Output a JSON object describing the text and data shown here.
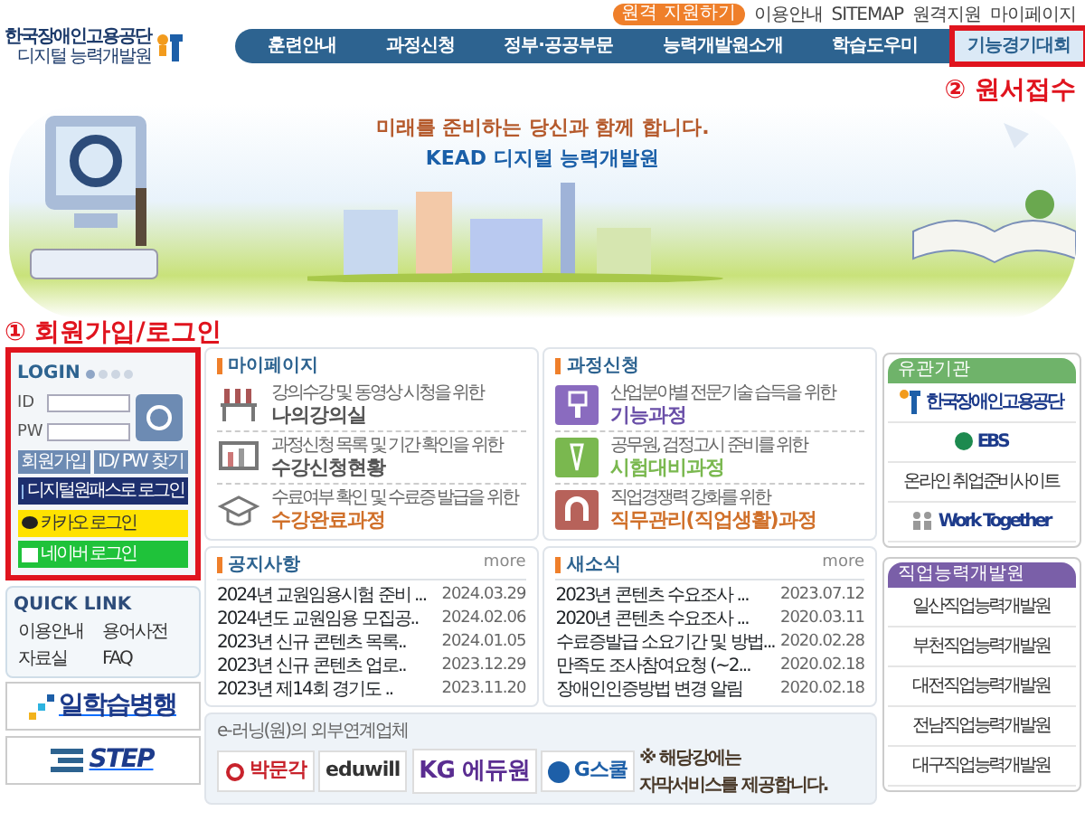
{
  "header": {
    "logo": {
      "line1": "한국장애인고용공단",
      "line2": "디지털 능력개발원"
    },
    "top_button": "원격 지원하기",
    "top_links": [
      "이용안내",
      "SITEMAP",
      "원격지원",
      "마이페이지"
    ],
    "nav": [
      {
        "label": "훈련안내",
        "selected": false
      },
      {
        "label": "과정신청",
        "selected": false
      },
      {
        "label": "정부·공공부문",
        "selected": false
      },
      {
        "label": "능력개발원소개",
        "selected": false
      },
      {
        "label": "학습도우미",
        "selected": false
      },
      {
        "label": "기능경기대회",
        "selected": true
      }
    ]
  },
  "annotations": [
    {
      "number": "②",
      "label": "원서접수"
    },
    {
      "number": "①",
      "label": "회원가입/로그인"
    }
  ],
  "banner": {
    "tagline": "미래를 준비하는 당신과 함께 합니다.",
    "title": "KEAD 디지털 능력개발원"
  },
  "login": {
    "title": "LOGIN",
    "id_label": "ID",
    "pw_label": "PW",
    "buttons": [
      "회원가입",
      "ID/ PW 찾기"
    ],
    "social": [
      {
        "kind": "onepass",
        "label": "디지털원패스로 로그인"
      },
      {
        "kind": "kakao",
        "label": "카카오 로그인"
      },
      {
        "kind": "naver",
        "label": "네이버 로그인"
      }
    ]
  },
  "quick_link": {
    "title": "QUICK LINK",
    "links": [
      "이용안내",
      "용어사전",
      "자료실",
      "FAQ"
    ]
  },
  "side_banners": [
    {
      "kind": "work",
      "label": "일학습병행"
    },
    {
      "kind": "step",
      "label": "STEP"
    }
  ],
  "panels": [
    {
      "title": "마이페이지",
      "items": [
        {
          "kind": "desk",
          "desc": "강의수강 및 동영상 시청을 위한",
          "label": "나의강의실"
        },
        {
          "kind": "board",
          "desc": "과정신청 목록 및 기간 확인을 위한",
          "label": "수강신청현황"
        },
        {
          "kind": "cap",
          "desc": "수료여부 확인 및 수료증 발급을 위한",
          "label": "수강완료과정"
        }
      ]
    },
    {
      "title": "과정신청",
      "items": [
        {
          "kind": "brush",
          "desc": "산업분야별 전문기술 습득을 위한",
          "label": "기능과정"
        },
        {
          "kind": "pen",
          "desc": "공무원, 검정고시 준비를 위한",
          "label": "시험대비과정"
        },
        {
          "kind": "magnet",
          "desc": "직업경쟁력 강화를 위한",
          "label": "직무관리(직업생활)과정"
        }
      ]
    }
  ],
  "boards": [
    {
      "title": "공지사항",
      "more": "more",
      "rows": [
        {
          "title": "2024년 교원임용시험 준비 ...",
          "date": "2024.03.29"
        },
        {
          "title": "2024년도 교원임용 모집공..",
          "date": "2024.02.06"
        },
        {
          "title": "2023년 신규 콘텐츠 목록..",
          "date": "2024.01.05"
        },
        {
          "title": "2023년 신규 콘텐츠 업로..",
          "date": "2023.12.29"
        },
        {
          "title": "2023년 제14회 경기도 ..",
          "date": "2023.11.20"
        }
      ]
    },
    {
      "title": "새소식",
      "more": "more",
      "rows": [
        {
          "title": "2023년 콘텐츠 수요조사 ...",
          "date": "2023.07.12"
        },
        {
          "title": "2020년 콘텐츠 수요조사 ...",
          "date": "2020.03.11"
        },
        {
          "title": "수료증발급 소요기간 및 방법...",
          "date": "2020.02.28"
        },
        {
          "title": "만족도 조사참여요청 (~2...",
          "date": "2020.02.18"
        },
        {
          "title": "장애인인증방법 변경 알림",
          "date": "2020.02.18"
        }
      ]
    }
  ],
  "partners": {
    "title": "e-러닝(원)의 외부연계업체",
    "logos": [
      {
        "kind": "pmg",
        "label": "박문각"
      },
      {
        "kind": "eduwill",
        "label": "eduwill"
      },
      {
        "kind": "kg",
        "label": "KG 에듀원"
      },
      {
        "kind": "gschool",
        "label": "G스쿨"
      }
    ],
    "note": [
      "※ 해당강에는",
      "자막서비스를 제공합니다."
    ]
  },
  "right_boxes": [
    {
      "title": "유관기관",
      "items": [
        {
          "kind": "kead",
          "label": "한국장애인고용공단"
        },
        {
          "kind": "ebs",
          "label": "EBS"
        },
        {
          "kind": "text",
          "label": "온라인 취업준비사이트"
        },
        {
          "kind": "work",
          "label": "Work Together"
        }
      ]
    },
    {
      "title": "직업능력개발원",
      "items": [
        {
          "kind": "text",
          "label": "일산직업능력개발원"
        },
        {
          "kind": "text",
          "label": "부천직업능력개발원"
        },
        {
          "kind": "text",
          "label": "대전직업능력개발원"
        },
        {
          "kind": "text",
          "label": "전남직업능력개발원"
        },
        {
          "kind": "text",
          "label": "대구직업능력개발원"
        }
      ]
    }
  ]
}
